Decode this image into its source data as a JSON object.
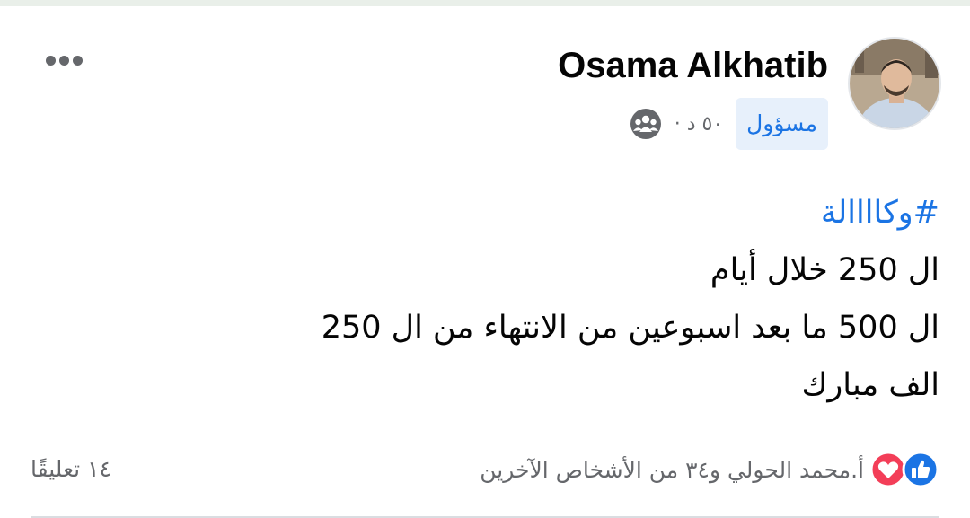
{
  "post": {
    "author": "Osama Alkhatib",
    "role_badge": "مسؤول",
    "time": "٥٠ د ·",
    "hashtag": "#وكاااالة",
    "lines": [
      "ال 250 خلال أيام",
      "ال 500 ما بعد اسبوعين من الانتهاء من ال 250",
      "الف مبارك"
    ]
  },
  "footer": {
    "reactions_text": "أ.محمد الحولي و٣٤ من الأشخاص الآخرين",
    "comments_text": "١٤ تعليقًا"
  },
  "icons": {
    "more": "more-horizontal-icon",
    "audience": "group-audience-icon",
    "like": "like-reaction-icon",
    "love": "love-reaction-icon"
  },
  "colors": {
    "link_blue": "#1b74e4",
    "badge_bg": "#e7f0fb",
    "secondary_text": "#65676b",
    "love_red": "#f33e58"
  }
}
